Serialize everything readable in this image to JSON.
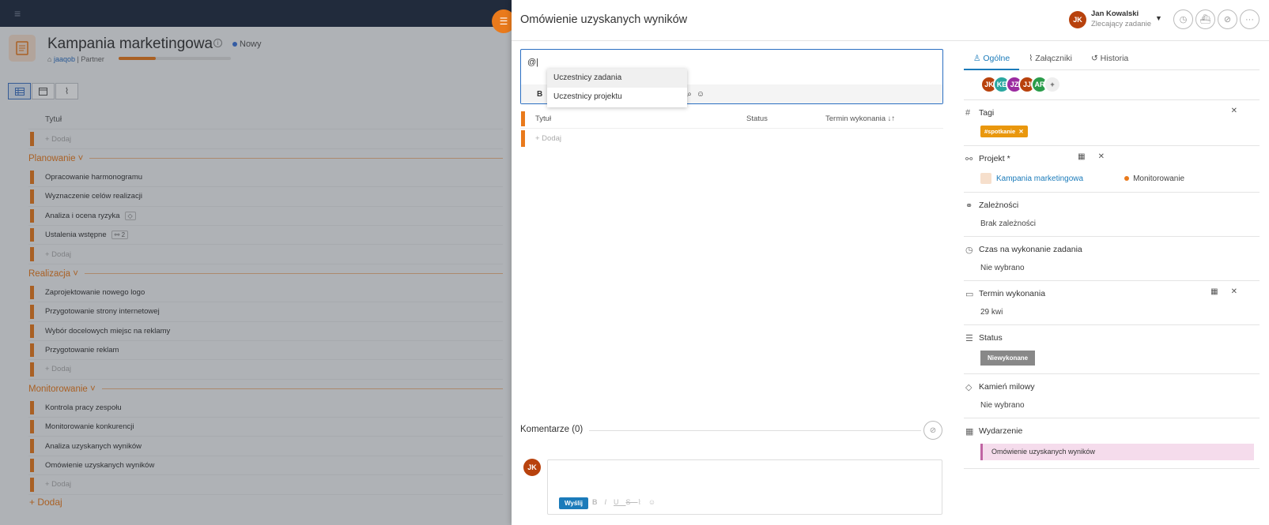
{
  "project": {
    "title": "Kampania marketingowa",
    "status": "Nowy",
    "tag": "jaaqob",
    "separator": "|",
    "role": "Partner",
    "progress": 0.33,
    "add_main": "+ Dodaj",
    "list": {
      "header": "Tytuł",
      "add": "+ Dodaj",
      "groups": [
        {
          "name": "Planowanie",
          "items": [
            "Opracowanie harmonogramu",
            "Wyznaczenie celów realizacji",
            "Analiza i ocena ryzyka",
            "Ustalenia wstępne"
          ],
          "badge_count": "2"
        },
        {
          "name": "Realizacja",
          "items": [
            "Zaprojektowanie nowego logo",
            "Przygotowanie strony internetowej",
            "Wybór docelowych miejsc na reklamy",
            "Przygotowanie reklam"
          ]
        },
        {
          "name": "Monitorowanie",
          "items": [
            "Kontrola pracy zespołu",
            "Monitorowanie konkurencji",
            "Analiza uzyskanych wyników",
            "Omówienie uzyskanych wyników"
          ]
        }
      ]
    }
  },
  "panel": {
    "title": "Omówienie uzyskanych wyników",
    "user": {
      "initials": "JK",
      "name": "Jan Kowalski",
      "role": "Zlecający zadanie"
    },
    "editor": {
      "text": "@|",
      "bold": "B",
      "mention_options": [
        "Uczestnicy zadania",
        "Uczestnicy projektu"
      ]
    },
    "subtasks": {
      "col_title": "Tytuł",
      "col_status": "Status",
      "col_due": "Termin wykonania ↓↑",
      "add": "+ Dodaj"
    },
    "comments": {
      "heading": "Komentarze (0)",
      "author_initials": "JK",
      "send": "Wyślij"
    },
    "tabs": [
      "Ogólne",
      "Załączniki",
      "Historia"
    ],
    "participants": [
      {
        "initials": "JK",
        "color": "#b8420d"
      },
      {
        "initials": "KE",
        "color": "#2aa7a0"
      },
      {
        "initials": "JZ",
        "color": "#9b2aa0"
      },
      {
        "initials": "JJ",
        "color": "#b8420d"
      },
      {
        "initials": "AR",
        "color": "#2a9c4a"
      }
    ],
    "participants_more": "+",
    "fields": {
      "tags_label": "Tagi",
      "tag_value": "#spotkanie",
      "tag_remove": "✕",
      "project_label": "Projekt *",
      "project_value": "Kampania marketingowa",
      "project_group": "Monitorowanie",
      "dependencies_label": "Zależności",
      "dependencies_value": "Brak zależności",
      "time_label": "Czas na wykonanie zadania",
      "time_value": "Nie wybrano",
      "due_label": "Termin wykonania",
      "due_value": "29 kwi",
      "status_label": "Status",
      "status_value": "Niewykonane",
      "milestone_label": "Kamień milowy",
      "milestone_value": "Nie wybrano",
      "event_label": "Wydarzenie",
      "event_value": "Omówienie uzyskanych wyników"
    }
  }
}
